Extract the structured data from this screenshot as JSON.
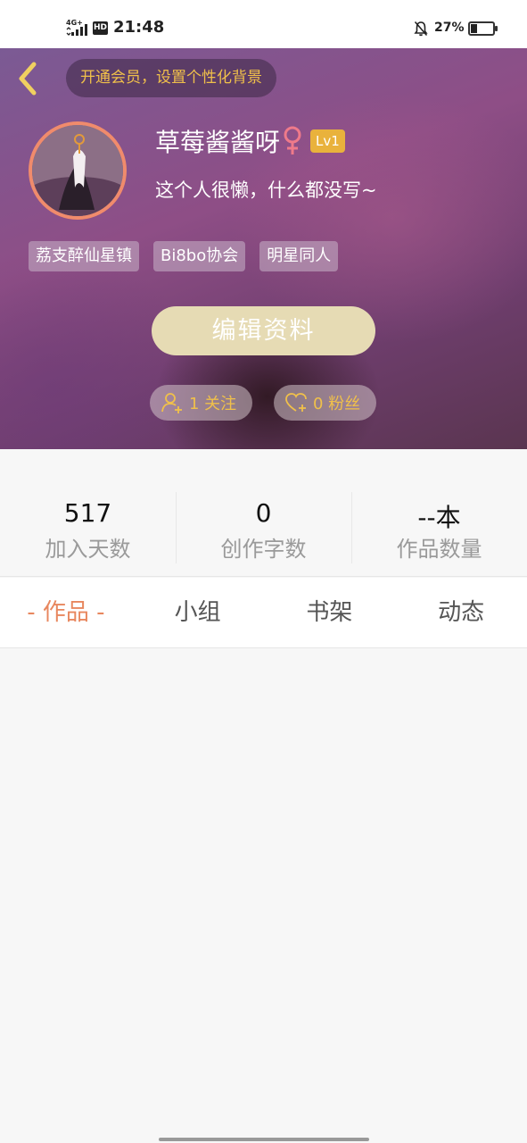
{
  "status_bar": {
    "network": "4G+",
    "hd": "HD",
    "time": "21:48",
    "battery": "27%",
    "battery_level": 0.27
  },
  "header": {
    "promo": "开通会员，设置个性化背景",
    "username": "草莓酱酱呀",
    "gender_symbol": "♀",
    "level": "Lv1",
    "bio": "这个人很懒，什么都没写~",
    "tags": [
      "荔支醉仙星镇",
      "Bi8bo协会",
      "明星同人"
    ],
    "edit_button": "编辑资料",
    "following_label": "1 关注",
    "fans_label": "0 粉丝"
  },
  "stats": [
    {
      "value": "517",
      "label": "加入天数"
    },
    {
      "value": "0",
      "label": "创作字数"
    },
    {
      "value": "--本",
      "label": "作品数量"
    }
  ],
  "tabs": [
    {
      "label": "- 作品 -",
      "active": true
    },
    {
      "label": "小组",
      "active": false
    },
    {
      "label": "书架",
      "active": false
    },
    {
      "label": "动态",
      "active": false
    }
  ],
  "colors": {
    "accent": "#e8875e",
    "gold": "#f0c04a",
    "level_badge": "#e9b23c",
    "edit_button": "#e6dbb4",
    "avatar_ring": "#f08b6c"
  }
}
